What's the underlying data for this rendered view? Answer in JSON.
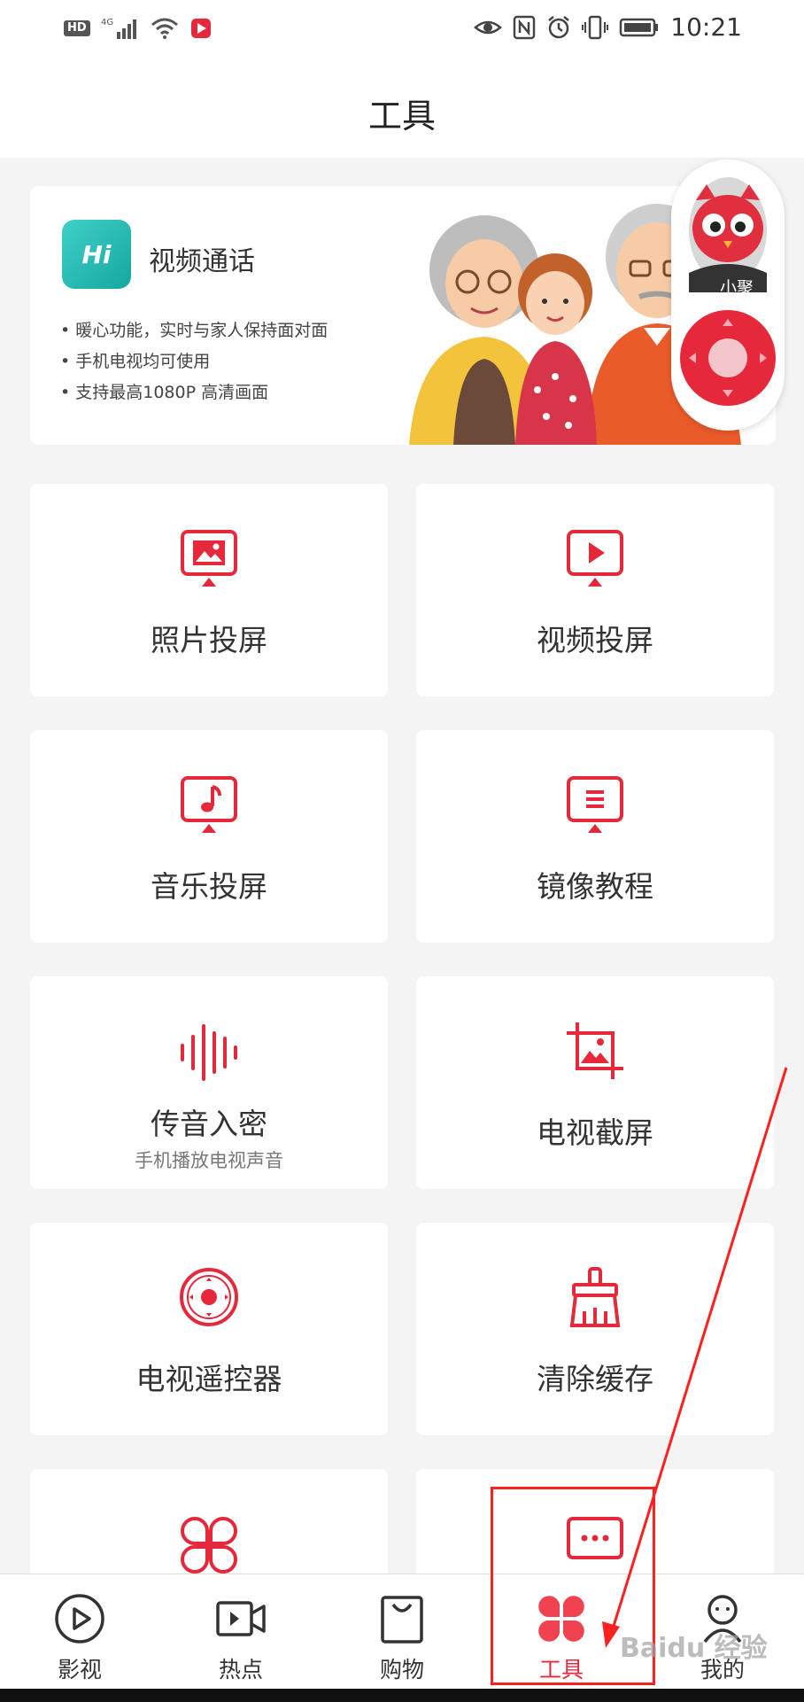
{
  "status_bar": {
    "left_icons": [
      "hd-icon",
      "signal-4g-icon",
      "wifi-icon",
      "app-notify-icon"
    ],
    "hd_label": "HD",
    "right_icons": [
      "eye-comfort-icon",
      "nfc-icon",
      "alarm-icon",
      "vibrate-icon",
      "battery-icon"
    ],
    "time": "10:21"
  },
  "header": {
    "title": "工具"
  },
  "banner": {
    "logo_text": "Hi",
    "title": "视频通话",
    "bullets": [
      "• 暖心功能，实时与家人保持面对面",
      "• 手机电视均可使用",
      "• 支持最高1080P 高清画面"
    ]
  },
  "floating": {
    "mascot_label": "小聚"
  },
  "tools": [
    {
      "label": "照片投屏",
      "sub": "",
      "icon": "photo-cast-icon"
    },
    {
      "label": "视频投屏",
      "sub": "",
      "icon": "video-cast-icon"
    },
    {
      "label": "音乐投屏",
      "sub": "",
      "icon": "music-cast-icon"
    },
    {
      "label": "镜像教程",
      "sub": "",
      "icon": "mirror-tutorial-icon"
    },
    {
      "label": "传音入密",
      "sub": "手机播放电视声音",
      "icon": "sound-wave-icon"
    },
    {
      "label": "电视截屏",
      "sub": "",
      "icon": "tv-screenshot-icon"
    },
    {
      "label": "电视遥控器",
      "sub": "",
      "icon": "tv-remote-icon"
    },
    {
      "label": "清除缓存",
      "sub": "",
      "icon": "clear-cache-icon"
    }
  ],
  "tabs": [
    {
      "label": "影视",
      "icon": "play-circle-icon",
      "active": false
    },
    {
      "label": "热点",
      "icon": "video-camera-icon",
      "active": false
    },
    {
      "label": "购物",
      "icon": "shopping-bag-icon",
      "active": false
    },
    {
      "label": "工具",
      "icon": "clover-icon",
      "active": true
    },
    {
      "label": "我的",
      "icon": "profile-icon",
      "active": false
    }
  ],
  "colors": {
    "accent": "#e6283b",
    "annotation": "#ff2020"
  },
  "watermark": "Baidu 经验"
}
